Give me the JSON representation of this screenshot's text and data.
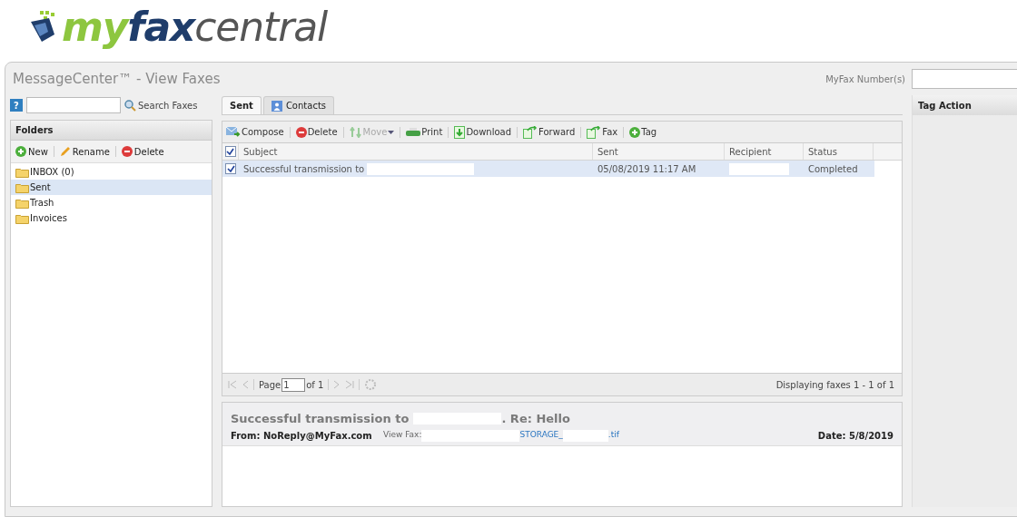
{
  "logo": {
    "part_1": "my",
    "part_2": "fax",
    "part_3": "central"
  },
  "window": {
    "title": "MessageCenter™ - View Faxes"
  },
  "fax_number": {
    "label": "MyFax Number(s)"
  },
  "search": {
    "help": "?",
    "button": "Search Faxes"
  },
  "folders": {
    "title": "Folders",
    "actions": [
      {
        "kind": "new",
        "label": "New"
      },
      {
        "kind": "rename",
        "label": "Rename"
      },
      {
        "kind": "delete",
        "label": "Delete"
      }
    ],
    "items": [
      {
        "label": "INBOX (0)",
        "selected": false
      },
      {
        "label": "Sent",
        "selected": true
      },
      {
        "label": "Trash",
        "selected": false
      },
      {
        "label": "Invoices",
        "selected": false
      }
    ]
  },
  "tabs": [
    {
      "label": "Sent",
      "selected": true,
      "kind": "plain"
    },
    {
      "label": "Contacts",
      "selected": false,
      "kind": "contacts"
    }
  ],
  "toolbar": [
    {
      "kind": "compose",
      "label": "Compose",
      "disabled": false
    },
    {
      "kind": "delete",
      "label": "Delete",
      "disabled": false
    },
    {
      "kind": "move",
      "label": "Move",
      "disabled": true
    },
    {
      "kind": "print",
      "label": "Print",
      "disabled": false
    },
    {
      "kind": "download",
      "label": "Download",
      "disabled": false
    },
    {
      "kind": "forward",
      "label": "Forward",
      "disabled": false
    },
    {
      "kind": "fax",
      "label": "Fax",
      "disabled": false
    },
    {
      "kind": "tag",
      "label": "Tag",
      "disabled": false
    }
  ],
  "table": {
    "all_checked": true,
    "columns": [
      "Subject",
      "Sent",
      "Recipient",
      "Status"
    ],
    "rows": [
      {
        "checked": true,
        "selected": true,
        "subject": "Successful transmission to",
        "sent": "05/08/2019 11:17 AM",
        "status": "Completed"
      }
    ]
  },
  "pager": {
    "page_label": "Page",
    "page": "1",
    "of": "of 1",
    "summary": "Displaying faxes 1 - 1 of 1"
  },
  "preview": {
    "title_start": "Successful transmission to",
    "title_end": ". Re: Hello",
    "from": "From: NoReply@MyFax.com",
    "view_label": "View Fax:",
    "link_part_1": "STORAGE_",
    "link_part_2": ".tif",
    "date": "Date: 5/8/2019"
  },
  "tag_panel": {
    "title": "Tag Action"
  }
}
